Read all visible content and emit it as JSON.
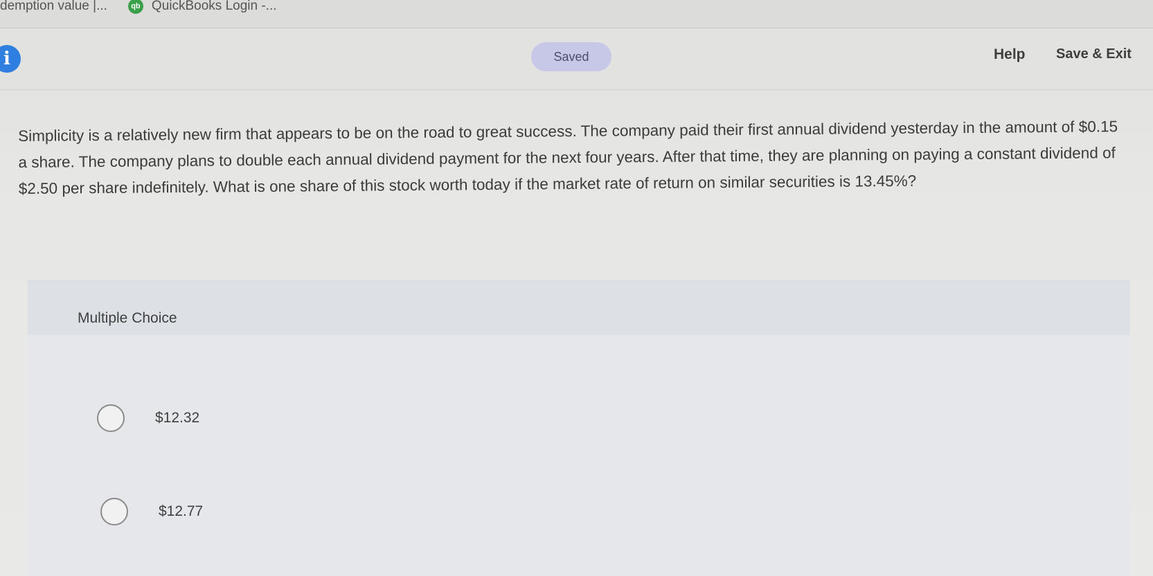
{
  "bookmarks": {
    "items": [
      {
        "label": "demption value |..."
      },
      {
        "label": "QuickBooks Login -...",
        "icon": "quickbooks-icon",
        "icon_text": "qb"
      }
    ]
  },
  "header": {
    "info_icon_glyph": "i",
    "status": "Saved",
    "help_label": "Help",
    "save_exit_label": "Save & Exit"
  },
  "question": {
    "text": "Simplicity is a relatively new firm that appears to be on the road to great success. The company paid their first annual dividend yesterday in the amount of $0.15 a share. The company plans to double each annual dividend payment for the next four years. After that time, they are planning on paying a constant dividend of $2.50 per share indefinitely. What is one share of this stock worth today if the market rate of return on similar securities is 13.45%?"
  },
  "multiple_choice": {
    "title": "Multiple Choice",
    "options": [
      {
        "label": "$12.32",
        "selected": false
      },
      {
        "label": "$12.77",
        "selected": false
      }
    ]
  },
  "colors": {
    "info_icon": "#2f7fe0",
    "saved_pill": "#c7c7e8",
    "quickbooks_icon": "#3aa04a"
  }
}
